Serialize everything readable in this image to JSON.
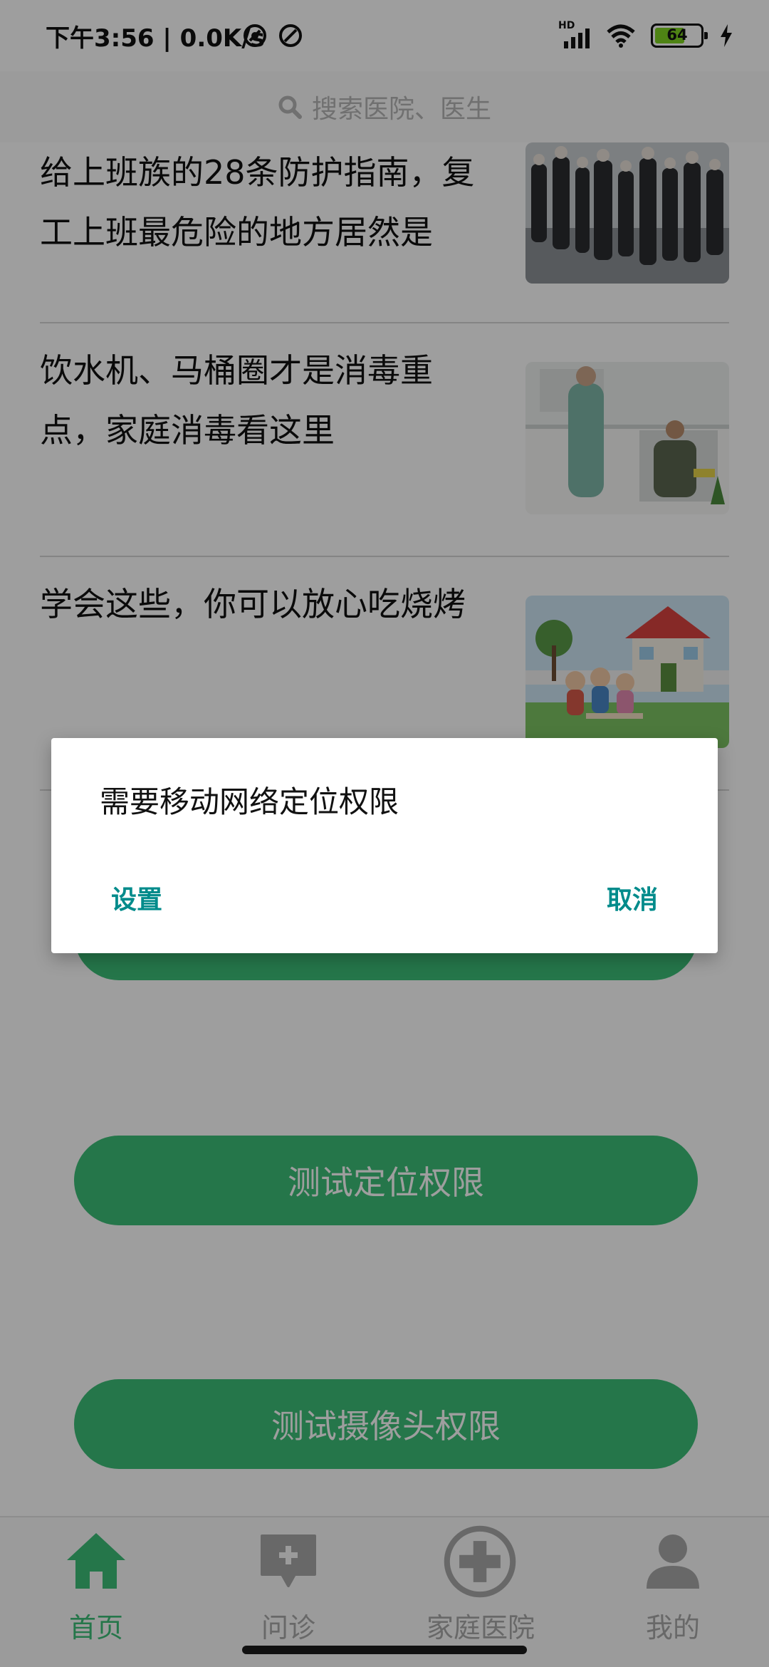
{
  "status_bar": {
    "time_speed": "下午3:56 | 0.0K/s",
    "network_label": "HD",
    "battery_level": "64",
    "icons": [
      "privacy-dot-icon",
      "do-not-disturb-icon",
      "signal-icon",
      "wifi-icon",
      "battery-icon",
      "charging-icon"
    ]
  },
  "search": {
    "placeholder": "搜索医院、医生",
    "icon": "search-icon"
  },
  "news": [
    {
      "title": "给上班族的28条防护指南，复工上班最危险的地方居然是",
      "image": "crowd-photo"
    },
    {
      "title": "饮水机、马桶圈才是消毒重点，家庭消毒看这里",
      "image": "kitchen-photo"
    },
    {
      "title": "学会这些，你可以放心吃烧烤",
      "image": "family-house-illustration"
    }
  ],
  "test_buttons": {
    "location": "测试定位权限",
    "camera": "测试摄像头权限"
  },
  "tabs": [
    {
      "label": "首页",
      "icon": "home-icon",
      "active": true
    },
    {
      "label": "问诊",
      "icon": "consult-chat-icon",
      "active": false
    },
    {
      "label": "家庭医院",
      "icon": "medical-cross-icon",
      "active": false
    },
    {
      "label": "我的",
      "icon": "user-icon",
      "active": false
    }
  ],
  "dialog": {
    "message": "需要移动网络定位权限",
    "positive": "设置",
    "negative": "取消"
  },
  "colors": {
    "accent_green": "#3dbf78",
    "dialog_button": "#008b8b",
    "scrim": "rgba(0,0,0,0.38)"
  }
}
